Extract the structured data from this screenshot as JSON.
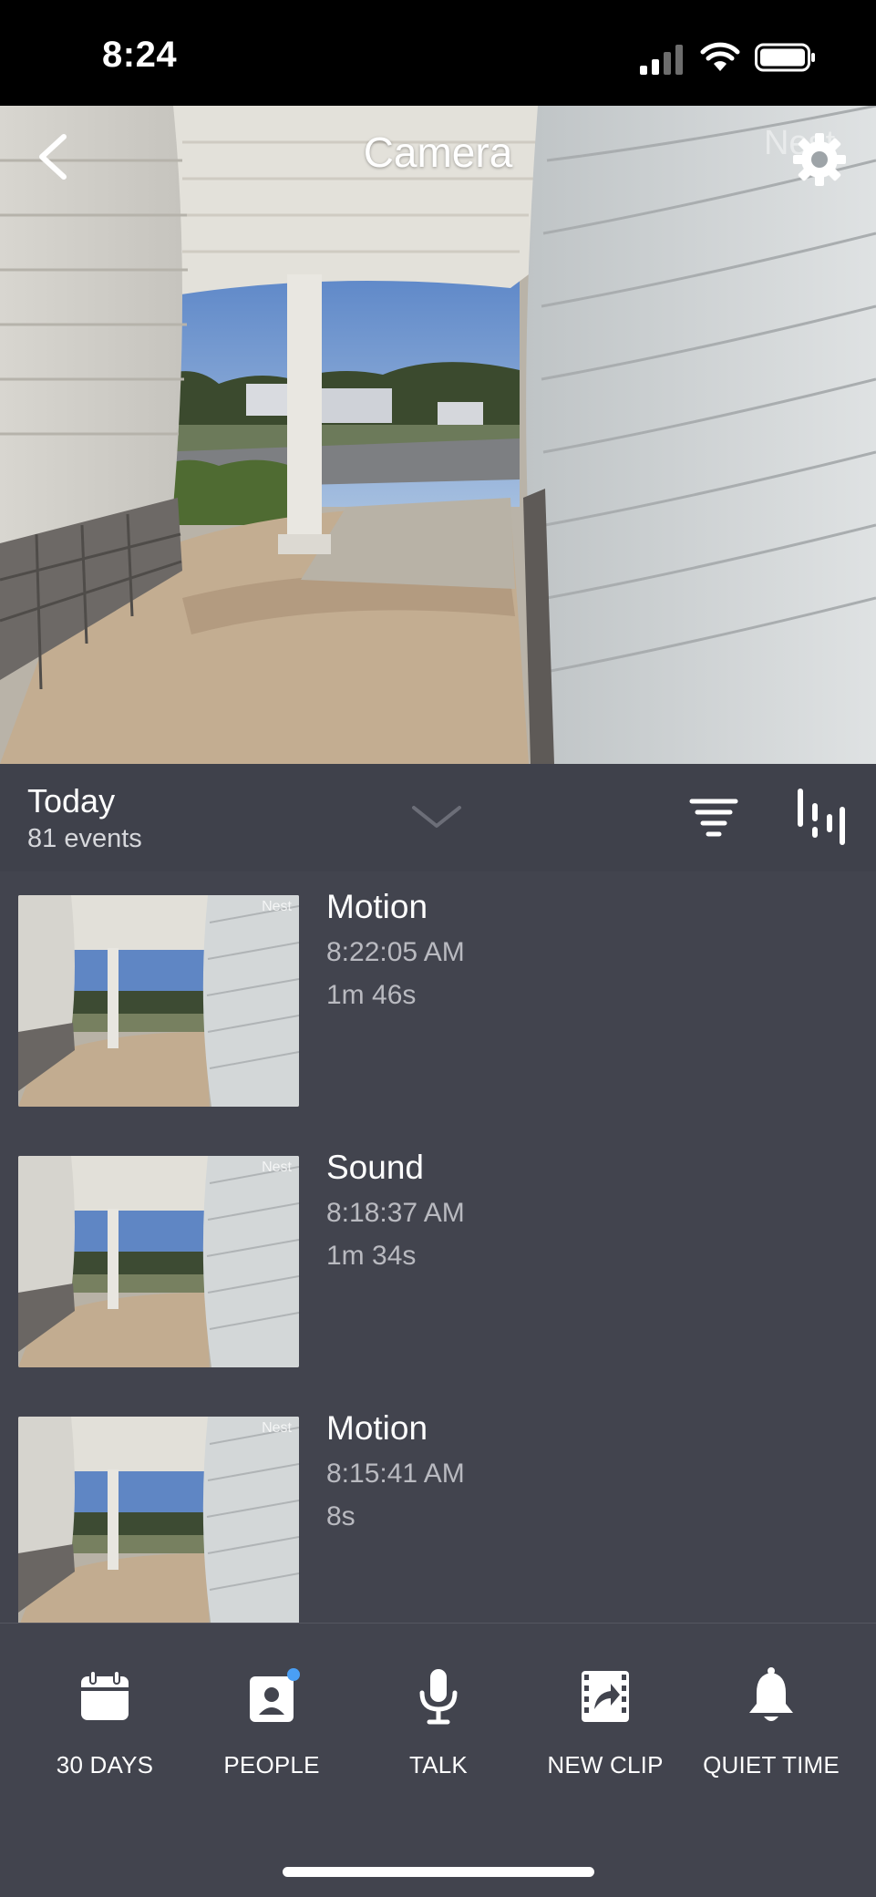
{
  "status_bar": {
    "time": "8:24"
  },
  "header": {
    "title": "Camera",
    "watermark": "Nest"
  },
  "feed": {
    "day_label": "Today",
    "event_count": "81 events"
  },
  "events": [
    {
      "type": "Motion",
      "time": "8:22:05 AM",
      "duration": "1m 46s",
      "thumb_mark": "Nest"
    },
    {
      "type": "Sound",
      "time": "8:18:37 AM",
      "duration": "1m 34s",
      "thumb_mark": "Nest"
    },
    {
      "type": "Motion",
      "time": "8:15:41 AM",
      "duration": "8s",
      "thumb_mark": "Nest"
    }
  ],
  "toolbar": [
    {
      "label": "30 DAYS",
      "icon": "calendar-icon"
    },
    {
      "label": "PEOPLE",
      "icon": "people-icon",
      "badge_color": "#4a9ff5"
    },
    {
      "label": "TALK",
      "icon": "microphone-icon"
    },
    {
      "label": "NEW CLIP",
      "icon": "clip-icon"
    },
    {
      "label": "QUIET TIME",
      "icon": "bell-icon"
    }
  ],
  "colors": {
    "background": "#42444e",
    "accent": "#4a9ff5"
  }
}
